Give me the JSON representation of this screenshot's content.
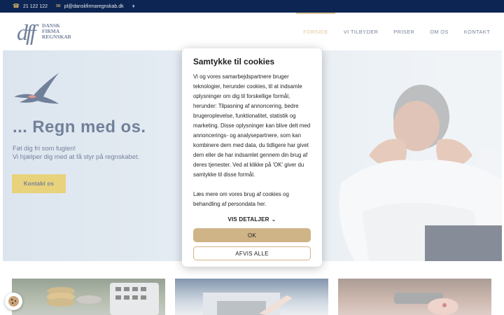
{
  "topbar": {
    "phone": "21 122 122",
    "email": "pl@danskfirmaregnskab.dk",
    "phone_icon": "phone-icon",
    "email_icon": "mail-icon",
    "extra_icon": "drop-icon"
  },
  "logo": {
    "mark": "dff",
    "lines": [
      "DANSK",
      "FIRMA",
      "REGNSKAB"
    ]
  },
  "nav": [
    {
      "label": "FORSIDE",
      "active": true
    },
    {
      "label": "VI TILBYDER"
    },
    {
      "label": "PRISER"
    },
    {
      "label": "OM OS"
    },
    {
      "label": "KONTAKT"
    }
  ],
  "hero": {
    "title": "... Regn med os.",
    "subtitle_1": "Føl dig fri som fuglen!",
    "subtitle_2": "Vi hjælper dig med at få styr på regnskabet.",
    "cta": "Kontakt os"
  },
  "cookie_modal": {
    "title": "Samtykke til cookies",
    "body": "Vi og vores samarbejdspartnere bruger teknologier, herunder cookies, til at indsamle oplysninger om dig til forskellige formål, herunder: Tilpasning af annoncering, bedre brugeroplevelse, funktionalitet, statistik og marketing. Disse oplysninger kan blive delt med annoncerings- og analysepartnere, som kan kombinere dem med data, du tidligere har givet dem eller de har indsamlet gennem din brug af deres tjenester. Ved at klikke på 'OK' giver du samtykke til disse formål.",
    "more": "Læs mere om vores brug af cookies og behandling af persondata her.",
    "details": "VIS DETALJER",
    "ok": "OK",
    "reject": "AFVIS ALLE"
  },
  "colors": {
    "navy": "#0c2552",
    "gold": "#c9a14b",
    "cta": "#d8b21c",
    "ok_button": "#cfb487"
  }
}
